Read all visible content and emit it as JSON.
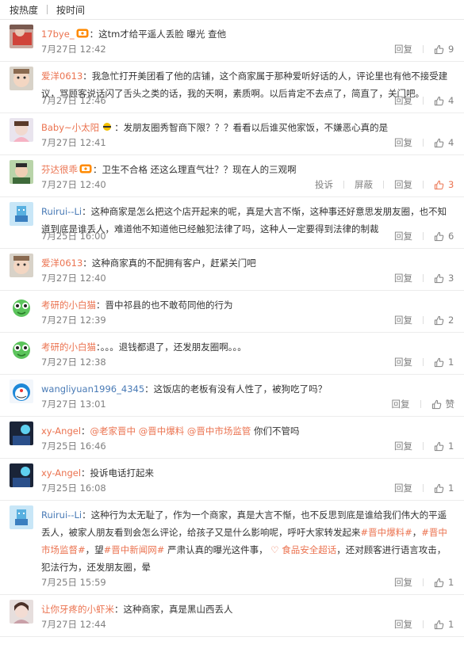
{
  "tabs": {
    "hot": "按热度",
    "time": "按时间"
  },
  "labels": {
    "reply": "回复",
    "report": "投诉",
    "block": "屏蔽",
    "like_word": "赞"
  },
  "colors": {
    "username": "#eb7350",
    "meta": "#808080",
    "text": "#333333"
  },
  "comments": [
    {
      "user": "17bye_",
      "segments": [
        {
          "t": "：这tm才给平遥人丢脸 曝光 查他"
        }
      ],
      "time": "7月27日 12:42",
      "likes": "9"
    },
    {
      "user": "爱洋0613",
      "segments": [
        {
          "t": "：我急忙打开美团看了他的店铺，这个商家属于那种爱听好话的人，评论里也有他不接受建议，骂顾客说话闪了舌头之类的话，我的天啊，素质啊。以后肯定不去点了，简直了，关门吧。"
        }
      ],
      "time": "7月27日 12:46",
      "likes": "4"
    },
    {
      "user": "Baby~小太阳",
      "segments": [
        {
          "t": "：发朋友圈秀智商下限？？？看看以后谁买他家饭，不嫌恶心真的是"
        }
      ],
      "time": "7月27日 12:41",
      "likes": "4"
    },
    {
      "user": "芬达很乖",
      "segments": [
        {
          "t": "：卫生不合格 还这么理直气壮？？现在人的三观啊"
        }
      ],
      "time": "7月27日 12:40",
      "likes": "3"
    },
    {
      "user": "Ruirui--Li",
      "segments": [
        {
          "t": "：这种商家是怎么把这个店开起来的呢，真是大言不惭，这种事还好意思发朋友圈，也不知道到底是谁丢人，难道他不知道他已经触犯法律了吗，这种人一定要得到法律的制裁"
        }
      ],
      "time": "7月25日 16:00",
      "likes": "6"
    },
    {
      "user": "爱洋0613",
      "segments": [
        {
          "t": "：这种商家真的不配拥有客户，赶紧关门吧"
        }
      ],
      "time": "7月27日 12:40",
      "likes": "3"
    },
    {
      "user": "考研的小白猫",
      "segments": [
        {
          "t": "：晋中祁县的也不敢苟同他的行为"
        }
      ],
      "time": "7月27日 12:39",
      "likes": "2"
    },
    {
      "user": "考研的小白猫",
      "segments": [
        {
          "t": "：。。。退钱都退了，还发朋友圈啊。。。"
        }
      ],
      "time": "7月27日 12:38",
      "likes": "1"
    },
    {
      "user": "wangliyuan1996_4345",
      "segments": [
        {
          "t": "：这饭店的老板有没有人性了，被狗吃了吗？"
        }
      ],
      "time": "7月27日 13:01",
      "likes": "赞"
    },
    {
      "user": "xy-Angel",
      "segments": [
        {
          "t": "："
        },
        {
          "t": "@老家晋中",
          "m": true
        },
        {
          "t": " "
        },
        {
          "t": "@晋中爆料",
          "m": true
        },
        {
          "t": " "
        },
        {
          "t": "@晋中市场监管",
          "m": true
        },
        {
          "t": " 你们不管吗"
        }
      ],
      "time": "7月25日 16:46",
      "likes": "1"
    },
    {
      "user": "xy-Angel",
      "segments": [
        {
          "t": "：投诉电话打起来"
        }
      ],
      "time": "7月25日 16:08",
      "likes": "1"
    },
    {
      "user": "Ruirui--Li",
      "segments": [
        {
          "t": "：这种行为太无耻了，作为一个商家，真是大言不惭，也不反思到底是谁给我们伟大的平遥丢人，被家人朋友看到会怎么评论，给孩子又是什么影响呢，呼吁大家转发起来"
        },
        {
          "t": "#晋中爆料#",
          "m": true
        },
        {
          "t": "，"
        },
        {
          "t": "#晋中市场监督#",
          "m": true
        },
        {
          "t": "，望"
        },
        {
          "t": "#晋中新闻网#",
          "m": true
        },
        {
          "t": " 严肃认真的曝光这件事，"
        },
        {
          "t": " ♡ 食品安全超话",
          "m": true
        },
        {
          "t": "，还对顾客进行语言攻击，犯法行为，还发朋友圈，晕"
        }
      ],
      "time": "7月25日 15:59",
      "likes": "1"
    },
    {
      "user": "让你牙疼的小虾米",
      "segments": [
        {
          "t": "：这种商家，真是黑山西丢人"
        }
      ],
      "time": "7月27日 12:44",
      "likes": "1"
    }
  ]
}
